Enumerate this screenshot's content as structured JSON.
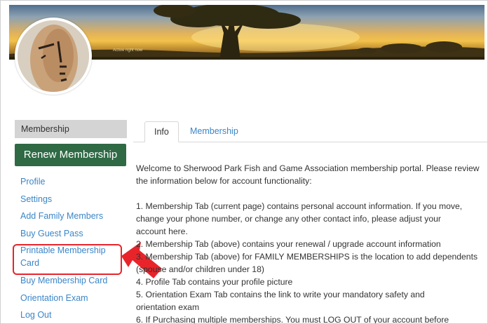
{
  "banner": {
    "caption": "Active right now"
  },
  "sidebar": {
    "header": "Membership",
    "renew_label": "Renew Membership",
    "items": [
      {
        "label": "Profile"
      },
      {
        "label": "Settings"
      },
      {
        "label": "Add Family Members"
      },
      {
        "label": "Buy Guest Pass"
      },
      {
        "label": "Printable Membership Card"
      },
      {
        "label": "Buy Membership Card"
      },
      {
        "label": "Orientation Exam"
      },
      {
        "label": "Log Out"
      }
    ]
  },
  "tabs": [
    {
      "label": "Info",
      "active": true
    },
    {
      "label": "Membership",
      "active": false
    }
  ],
  "content": {
    "intro": "Welcome to Sherwood Park Fish and Game Association membership portal. Please review the information below for account functionality:",
    "lines": [
      "1. Membership Tab (current page) contains personal account information. If you move,",
      "change your phone number, or change any other contact info, please adjust your",
      "account here.",
      "2. Membership Tab (above) contains your renewal / upgrade account information",
      "3. Membership Tab (above) for FAMILY MEMBERSHIPS is the location to add dependents",
      "(spouse and/or children under 18)",
      "4. Profile Tab contains your profile picture",
      "5. Orientation Exam Tab contains the link to write your mandatory safety and",
      "orientation exam",
      "6. If Purchasing multiple memberships. You must LOG OUT of your account before"
    ]
  },
  "colors": {
    "accent_green": "#2f6a45",
    "link_blue": "#3a86c8",
    "highlight_red": "#e8242a"
  }
}
